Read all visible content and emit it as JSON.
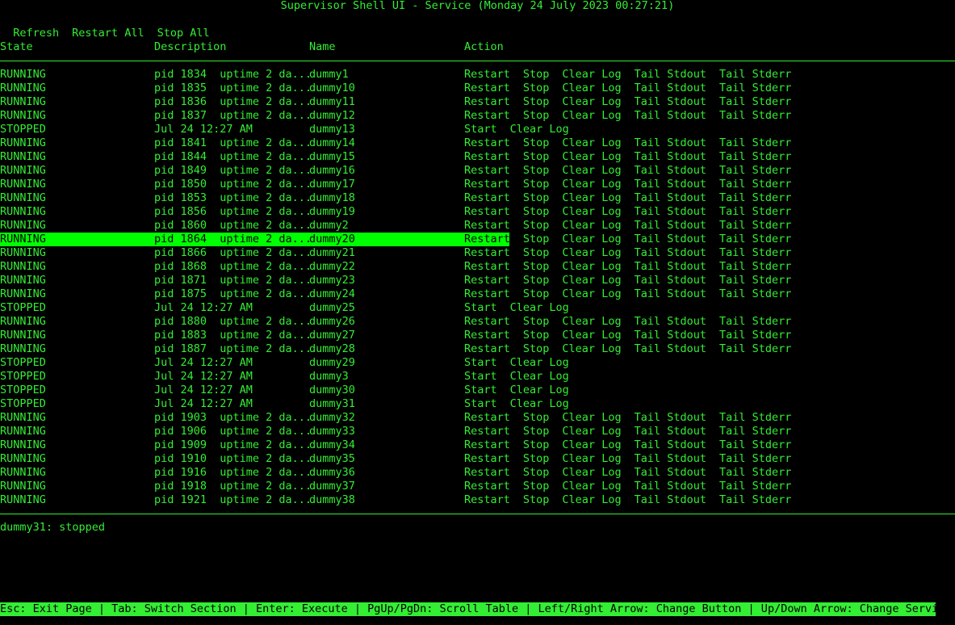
{
  "title": "Supervisor Shell UI - Service (Monday 24 July 2023 00:27:21)",
  "menu": [
    "Refresh",
    "Restart All",
    "Stop All"
  ],
  "columns": {
    "state": "State",
    "description": "Description",
    "name": "Name",
    "action": "Action"
  },
  "selected_index": 12,
  "services": [
    {
      "state": "RUNNING",
      "desc": "pid 1834  uptime 2 da...",
      "name": "dummy1"
    },
    {
      "state": "RUNNING",
      "desc": "pid 1835  uptime 2 da...",
      "name": "dummy10"
    },
    {
      "state": "RUNNING",
      "desc": "pid 1836  uptime 2 da...",
      "name": "dummy11"
    },
    {
      "state": "RUNNING",
      "desc": "pid 1837  uptime 2 da...",
      "name": "dummy12"
    },
    {
      "state": "STOPPED",
      "desc": "Jul 24 12:27 AM",
      "name": "dummy13"
    },
    {
      "state": "RUNNING",
      "desc": "pid 1841  uptime 2 da...",
      "name": "dummy14"
    },
    {
      "state": "RUNNING",
      "desc": "pid 1844  uptime 2 da...",
      "name": "dummy15"
    },
    {
      "state": "RUNNING",
      "desc": "pid 1849  uptime 2 da...",
      "name": "dummy16"
    },
    {
      "state": "RUNNING",
      "desc": "pid 1850  uptime 2 da...",
      "name": "dummy17"
    },
    {
      "state": "RUNNING",
      "desc": "pid 1853  uptime 2 da...",
      "name": "dummy18"
    },
    {
      "state": "RUNNING",
      "desc": "pid 1856  uptime 2 da...",
      "name": "dummy19"
    },
    {
      "state": "RUNNING",
      "desc": "pid 1860  uptime 2 da...",
      "name": "dummy2"
    },
    {
      "state": "RUNNING",
      "desc": "pid 1864  uptime 2 da...",
      "name": "dummy20"
    },
    {
      "state": "RUNNING",
      "desc": "pid 1866  uptime 2 da...",
      "name": "dummy21"
    },
    {
      "state": "RUNNING",
      "desc": "pid 1868  uptime 2 da...",
      "name": "dummy22"
    },
    {
      "state": "RUNNING",
      "desc": "pid 1871  uptime 2 da...",
      "name": "dummy23"
    },
    {
      "state": "RUNNING",
      "desc": "pid 1875  uptime 2 da...",
      "name": "dummy24"
    },
    {
      "state": "STOPPED",
      "desc": "Jul 24 12:27 AM",
      "name": "dummy25"
    },
    {
      "state": "RUNNING",
      "desc": "pid 1880  uptime 2 da...",
      "name": "dummy26"
    },
    {
      "state": "RUNNING",
      "desc": "pid 1883  uptime 2 da...",
      "name": "dummy27"
    },
    {
      "state": "RUNNING",
      "desc": "pid 1887  uptime 2 da...",
      "name": "dummy28"
    },
    {
      "state": "STOPPED",
      "desc": "Jul 24 12:27 AM",
      "name": "dummy29"
    },
    {
      "state": "STOPPED",
      "desc": "Jul 24 12:27 AM",
      "name": "dummy3"
    },
    {
      "state": "STOPPED",
      "desc": "Jul 24 12:27 AM",
      "name": "dummy30"
    },
    {
      "state": "STOPPED",
      "desc": "Jul 24 12:27 AM",
      "name": "dummy31"
    },
    {
      "state": "RUNNING",
      "desc": "pid 1903  uptime 2 da...",
      "name": "dummy32"
    },
    {
      "state": "RUNNING",
      "desc": "pid 1906  uptime 2 da...",
      "name": "dummy33"
    },
    {
      "state": "RUNNING",
      "desc": "pid 1909  uptime 2 da...",
      "name": "dummy34"
    },
    {
      "state": "RUNNING",
      "desc": "pid 1910  uptime 2 da...",
      "name": "dummy35"
    },
    {
      "state": "RUNNING",
      "desc": "pid 1916  uptime 2 da...",
      "name": "dummy36"
    },
    {
      "state": "RUNNING",
      "desc": "pid 1918  uptime 2 da...",
      "name": "dummy37"
    },
    {
      "state": "RUNNING",
      "desc": "pid 1921  uptime 2 da...",
      "name": "dummy38"
    }
  ],
  "actions": {
    "RUNNING": [
      "Restart",
      "Stop",
      "Clear Log",
      "Tail Stdout",
      "Tail Stderr"
    ],
    "STOPPED": [
      "Start",
      "Clear Log"
    ]
  },
  "status_message": "dummy31: stopped",
  "footer": "Esc: Exit Page | Tab: Switch Section | Enter: Execute | PgUp/PgDn: Scroll Table | Left/Right Arrow: Change Button | Up/Down Arrow: Change Service",
  "colors": {
    "foreground": "#33ee33",
    "background": "#000000",
    "highlight": "#00ff00"
  }
}
